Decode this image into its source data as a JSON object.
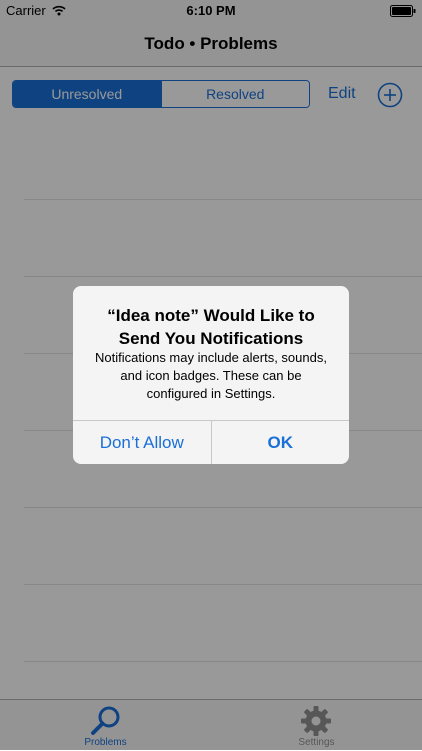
{
  "status_bar": {
    "carrier": "Carrier",
    "time": "6:10 PM",
    "icons": [
      "wifi-icon",
      "battery-icon"
    ]
  },
  "nav": {
    "title": "Todo • Problems"
  },
  "toolbar": {
    "segments": [
      {
        "label": "Unresolved",
        "selected": true
      },
      {
        "label": "Resolved",
        "selected": false
      }
    ],
    "edit_label": "Edit",
    "add_icon": "plus-circle-icon"
  },
  "alert": {
    "title": "“Idea note” Would Like to Send You Notifications",
    "message": "Notifications may include alerts, sounds, and icon badges. These can be configured in Settings.",
    "buttons": [
      "Don’t Allow",
      "OK"
    ]
  },
  "tab_bar": {
    "tabs": [
      {
        "label": "Problems",
        "icon": "search-icon",
        "active": true
      },
      {
        "label": "Settings",
        "icon": "gear-icon",
        "active": false
      }
    ]
  },
  "colors": {
    "accent": "#1a6fd8",
    "bar_background": "#f7f7f7",
    "inactive_tab": "#929292"
  }
}
